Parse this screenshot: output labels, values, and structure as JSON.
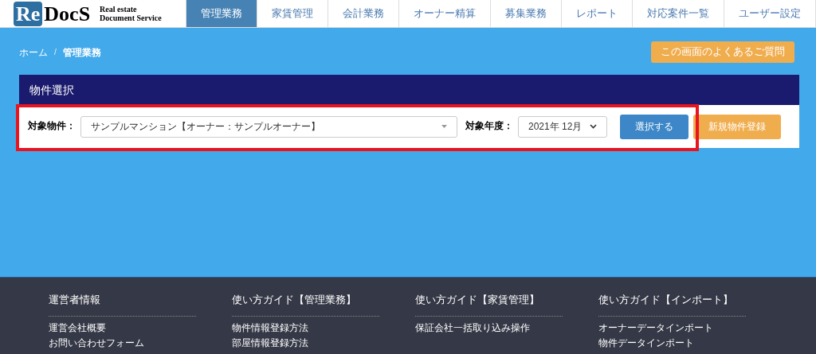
{
  "logo": {
    "mark_left": "Re",
    "mark_right": "DocS",
    "tagline_1": "Real estate",
    "tagline_2": "Document Service"
  },
  "nav": [
    {
      "label": "管理業務",
      "selected": true
    },
    {
      "label": "家賃管理",
      "selected": false
    },
    {
      "label": "会計業務",
      "selected": false
    },
    {
      "label": "オーナー精算",
      "selected": false
    },
    {
      "label": "募集業務",
      "selected": false
    },
    {
      "label": "レポート",
      "selected": false
    },
    {
      "label": "対応案件一覧",
      "selected": false
    },
    {
      "label": "ユーザー設定",
      "selected": false
    }
  ],
  "breadcrumb": [
    {
      "label": "ホーム"
    },
    {
      "label": "管理業務"
    }
  ],
  "breadcrumb_separator": "/",
  "faq_button": "この画面のよくあるご質問",
  "panel": {
    "title": "物件選択",
    "property_label": "対象物件：",
    "property_value": "サンプルマンション【オーナー：サンプルオーナー】",
    "year_label": "対象年度：",
    "year_value": "2021年 12月",
    "select_button": "選択する",
    "new_button": "新規物件登録"
  },
  "footer": [
    {
      "heading": "運営者情報",
      "links": [
        "運営会社概要",
        "お問い合わせフォーム"
      ]
    },
    {
      "heading": "使い方ガイド【管理業務】",
      "links": [
        "物件情報登録方法",
        "部屋情報登録方法"
      ]
    },
    {
      "heading": "使い方ガイド【家賃管理】",
      "links": [
        "保証会社一括取り込み操作"
      ]
    },
    {
      "heading": "使い方ガイド【インポート】",
      "links": [
        "オーナーデータインポート",
        "物件データインポート"
      ]
    }
  ]
}
